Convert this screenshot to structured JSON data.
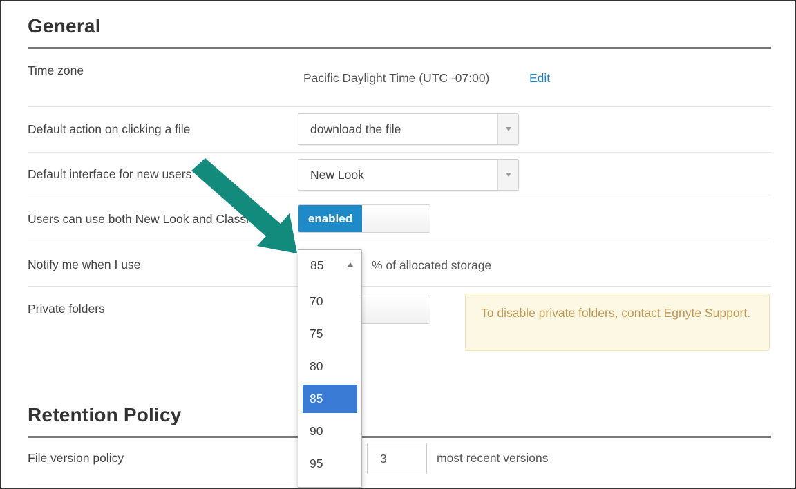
{
  "general": {
    "title": "General",
    "rows": {
      "time_zone": {
        "label": "Time zone",
        "value": "Pacific Daylight Time (UTC -07:00)",
        "edit_label": "Edit"
      },
      "default_action": {
        "label": "Default action on clicking a file",
        "selected": "download the file"
      },
      "default_interface": {
        "label": "Default interface for new users",
        "selected": "New Look"
      },
      "both_interfaces": {
        "label": "Users can use both New Look and Classic",
        "toggle_label": "enabled"
      },
      "notify": {
        "label": "Notify me when I use",
        "selected": "85",
        "suffix": "% of allocated storage",
        "options": [
          "70",
          "75",
          "80",
          "85",
          "90",
          "95"
        ]
      },
      "private_folders": {
        "label": "Private folders",
        "notice": "To disable private folders, contact Egnyte Support."
      }
    }
  },
  "retention": {
    "title": "Retention Policy",
    "file_version": {
      "label": "File version policy",
      "value": "3",
      "suffix": "most recent versions"
    }
  },
  "colors": {
    "accent": "#1f8ac8",
    "selected_option": "#3a7bd5",
    "arrow": "#128a7c",
    "notice_bg": "#fcf8e3",
    "notice_text": "#c09853"
  }
}
